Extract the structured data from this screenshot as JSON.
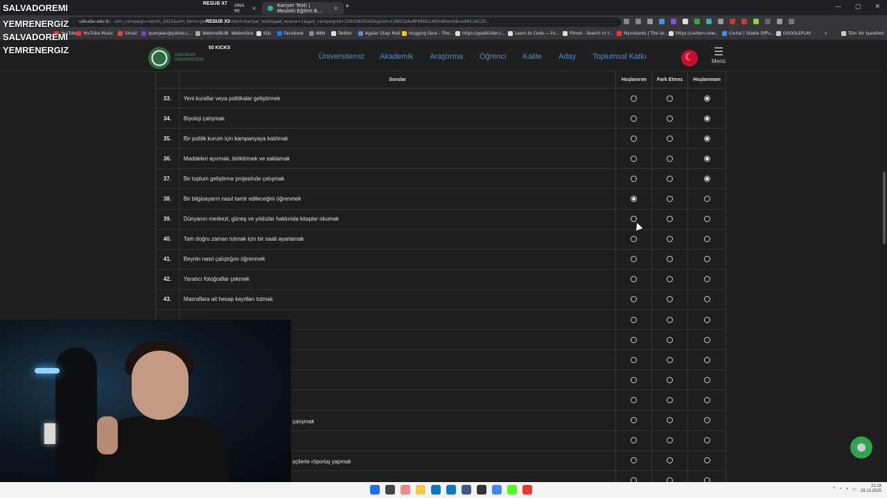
{
  "browser": {
    "tab_inactive": "ANA MI",
    "tab_active": "Kariyer Testi | Meslek&#305; Eğ&#305;t&#305;m B&#305;...",
    "url_host": "uskudar.edu.tr",
    "url_rest": "/...utm_campaign=tercih_2025&utm_term=pmax&utm_content=kariyer_testi&gad_source=1&gad_campaignid=22933935065&gclid=Cj0KCQiAx8PKBhD1ARIsAKsmGbcw9R11ACZ0...",
    "new_tab": "+",
    "window_controls": [
      "—",
      "▢",
      "✕"
    ]
  },
  "bookmarks": [
    {
      "label": "YouTube"
    },
    {
      "label": "YouTube Music"
    },
    {
      "label": "Gmail"
    },
    {
      "label": "quenjeen@yahoo.c..."
    },
    {
      "label": "Webmail"
    },
    {
      "label": "SUB"
    },
    {
      "label": "Webonline"
    },
    {
      "label": "SQL"
    },
    {
      "label": "Facebook"
    },
    {
      "label": "NBN"
    },
    {
      "label": "Twitter"
    },
    {
      "label": "Agalar Olayı Mail"
    },
    {
      "label": "Hugging Face – The..."
    },
    {
      "label": "https://goalkicker.c..."
    },
    {
      "label": "Learn to Code — Fo..."
    },
    {
      "label": "Filmot - Search in Y..."
    },
    {
      "label": "Myinstants | The lar..."
    },
    {
      "label": "https://carbon.now..."
    },
    {
      "label": "Civitai | Stable Diffu..."
    },
    {
      "label": "GOOGLEPLAY"
    },
    {
      "label": "»"
    },
    {
      "label": "Tüm Yer İşaretleri"
    }
  ],
  "site": {
    "logo_line1": "ÜSKÜDAR",
    "logo_line2": "ÜNİVERSİTESİ",
    "nav": [
      "Üniversitemiz",
      "Akademik",
      "Araştırma",
      "Öğrenci",
      "Kalite",
      "Aday",
      "Toplumsal Katkı"
    ],
    "menu_label": "Menü"
  },
  "table": {
    "headers": {
      "question": "Sorular",
      "opt1": "Hoşlanırım",
      "opt2": "Fark Etmez",
      "opt3": "Hoşlanmam"
    },
    "rows": [
      {
        "num": "33.",
        "q": "Yeni kurallar veya politikalar geliştirmek",
        "sel": 3
      },
      {
        "num": "34.",
        "q": "Biyoloji çalışmak",
        "sel": 3
      },
      {
        "num": "35.",
        "q": "Bir politik kurum için kampanyaya katılmak",
        "sel": 3
      },
      {
        "num": "36.",
        "q": "Maddeleri ayırmak, biriktirmek ve saklamak",
        "sel": 3
      },
      {
        "num": "37.",
        "q": "Bir toplum geliştirme projesinde çalışmak",
        "sel": 3
      },
      {
        "num": "38.",
        "q": "Bir bilgisayarın nasıl tamir edileceğini öğrenmek",
        "sel": 1
      },
      {
        "num": "39.",
        "q": "Dünyanın merkezi, güneş ve yıldızlar hakkında kitaplar okumak",
        "sel": 0
      },
      {
        "num": "40.",
        "q": "Tam doğru zaman tutmak için bir saati ayarlamak",
        "sel": 0
      },
      {
        "num": "41.",
        "q": "Beynin nasıl çalıştığını öğrenmek",
        "sel": 0
      },
      {
        "num": "42.",
        "q": "Yaratıcı fotoğraflar çekmek",
        "sel": 0
      },
      {
        "num": "43.",
        "q": "Masraflara ait hesap kayıtları tutmak",
        "sel": 0
      },
      {
        "num": "",
        "q": "",
        "sel": 0
      },
      {
        "num": "",
        "q": "",
        "sel": 0
      },
      {
        "num": "",
        "q": "",
        "sel": 0
      },
      {
        "num": "",
        "q": "",
        "sel": 0
      },
      {
        "num": "",
        "q": "",
        "sel": 0
      },
      {
        "num": "",
        "q": "",
        "sel": 0
      },
      {
        "num": "",
        "q": "",
        "sel": 0
      },
      {
        "num": "",
        "q": "",
        "sel": 0
      },
      {
        "num": "",
        "q": "",
        "sel": 0
      }
    ],
    "partial_texts": [
      "çalışmak",
      "şçilerle röportaj yapmak"
    ]
  },
  "overlay": {
    "name1": "SALVADOREMI",
    "name2": "YEMRENERGIZ",
    "name3": "SALVADOREMI",
    "name4": "YEMRENERGIZ",
    "badge1": "RESUB X7",
    "badge2": "RESUB X3",
    "badge3": "50 KICKS"
  },
  "taskbar": {
    "time": "21:18",
    "date": "28.12.2025"
  }
}
